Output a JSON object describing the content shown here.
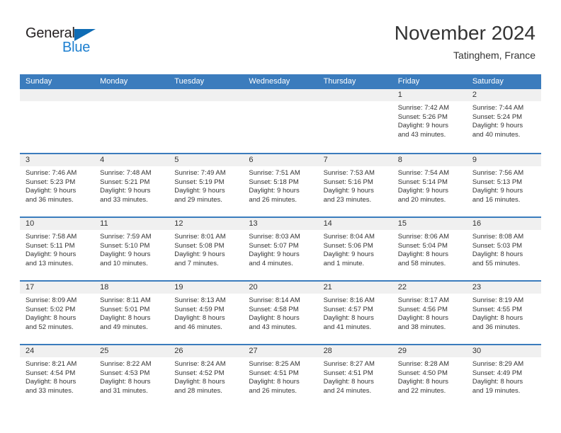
{
  "brand": {
    "name_part1": "General",
    "name_part2": "Blue",
    "triangle_color": "#0f6cb5",
    "blue_color": "#1c7fd0"
  },
  "header": {
    "title": "November 2024",
    "subtitle": "Tatinghem, France",
    "header_bg": "#3b7cbd",
    "daynum_bg": "#f0f0f0"
  },
  "weekday_headers": [
    "Sunday",
    "Monday",
    "Tuesday",
    "Wednesday",
    "Thursday",
    "Friday",
    "Saturday"
  ],
  "weeks": [
    [
      {
        "day": "",
        "lines": []
      },
      {
        "day": "",
        "lines": []
      },
      {
        "day": "",
        "lines": []
      },
      {
        "day": "",
        "lines": []
      },
      {
        "day": "",
        "lines": []
      },
      {
        "day": "1",
        "lines": [
          "Sunrise: 7:42 AM",
          "Sunset: 5:26 PM",
          "Daylight: 9 hours",
          "and 43 minutes."
        ]
      },
      {
        "day": "2",
        "lines": [
          "Sunrise: 7:44 AM",
          "Sunset: 5:24 PM",
          "Daylight: 9 hours",
          "and 40 minutes."
        ]
      }
    ],
    [
      {
        "day": "3",
        "lines": [
          "Sunrise: 7:46 AM",
          "Sunset: 5:23 PM",
          "Daylight: 9 hours",
          "and 36 minutes."
        ]
      },
      {
        "day": "4",
        "lines": [
          "Sunrise: 7:48 AM",
          "Sunset: 5:21 PM",
          "Daylight: 9 hours",
          "and 33 minutes."
        ]
      },
      {
        "day": "5",
        "lines": [
          "Sunrise: 7:49 AM",
          "Sunset: 5:19 PM",
          "Daylight: 9 hours",
          "and 29 minutes."
        ]
      },
      {
        "day": "6",
        "lines": [
          "Sunrise: 7:51 AM",
          "Sunset: 5:18 PM",
          "Daylight: 9 hours",
          "and 26 minutes."
        ]
      },
      {
        "day": "7",
        "lines": [
          "Sunrise: 7:53 AM",
          "Sunset: 5:16 PM",
          "Daylight: 9 hours",
          "and 23 minutes."
        ]
      },
      {
        "day": "8",
        "lines": [
          "Sunrise: 7:54 AM",
          "Sunset: 5:14 PM",
          "Daylight: 9 hours",
          "and 20 minutes."
        ]
      },
      {
        "day": "9",
        "lines": [
          "Sunrise: 7:56 AM",
          "Sunset: 5:13 PM",
          "Daylight: 9 hours",
          "and 16 minutes."
        ]
      }
    ],
    [
      {
        "day": "10",
        "lines": [
          "Sunrise: 7:58 AM",
          "Sunset: 5:11 PM",
          "Daylight: 9 hours",
          "and 13 minutes."
        ]
      },
      {
        "day": "11",
        "lines": [
          "Sunrise: 7:59 AM",
          "Sunset: 5:10 PM",
          "Daylight: 9 hours",
          "and 10 minutes."
        ]
      },
      {
        "day": "12",
        "lines": [
          "Sunrise: 8:01 AM",
          "Sunset: 5:08 PM",
          "Daylight: 9 hours",
          "and 7 minutes."
        ]
      },
      {
        "day": "13",
        "lines": [
          "Sunrise: 8:03 AM",
          "Sunset: 5:07 PM",
          "Daylight: 9 hours",
          "and 4 minutes."
        ]
      },
      {
        "day": "14",
        "lines": [
          "Sunrise: 8:04 AM",
          "Sunset: 5:06 PM",
          "Daylight: 9 hours",
          "and 1 minute."
        ]
      },
      {
        "day": "15",
        "lines": [
          "Sunrise: 8:06 AM",
          "Sunset: 5:04 PM",
          "Daylight: 8 hours",
          "and 58 minutes."
        ]
      },
      {
        "day": "16",
        "lines": [
          "Sunrise: 8:08 AM",
          "Sunset: 5:03 PM",
          "Daylight: 8 hours",
          "and 55 minutes."
        ]
      }
    ],
    [
      {
        "day": "17",
        "lines": [
          "Sunrise: 8:09 AM",
          "Sunset: 5:02 PM",
          "Daylight: 8 hours",
          "and 52 minutes."
        ]
      },
      {
        "day": "18",
        "lines": [
          "Sunrise: 8:11 AM",
          "Sunset: 5:01 PM",
          "Daylight: 8 hours",
          "and 49 minutes."
        ]
      },
      {
        "day": "19",
        "lines": [
          "Sunrise: 8:13 AM",
          "Sunset: 4:59 PM",
          "Daylight: 8 hours",
          "and 46 minutes."
        ]
      },
      {
        "day": "20",
        "lines": [
          "Sunrise: 8:14 AM",
          "Sunset: 4:58 PM",
          "Daylight: 8 hours",
          "and 43 minutes."
        ]
      },
      {
        "day": "21",
        "lines": [
          "Sunrise: 8:16 AM",
          "Sunset: 4:57 PM",
          "Daylight: 8 hours",
          "and 41 minutes."
        ]
      },
      {
        "day": "22",
        "lines": [
          "Sunrise: 8:17 AM",
          "Sunset: 4:56 PM",
          "Daylight: 8 hours",
          "and 38 minutes."
        ]
      },
      {
        "day": "23",
        "lines": [
          "Sunrise: 8:19 AM",
          "Sunset: 4:55 PM",
          "Daylight: 8 hours",
          "and 36 minutes."
        ]
      }
    ],
    [
      {
        "day": "24",
        "lines": [
          "Sunrise: 8:21 AM",
          "Sunset: 4:54 PM",
          "Daylight: 8 hours",
          "and 33 minutes."
        ]
      },
      {
        "day": "25",
        "lines": [
          "Sunrise: 8:22 AM",
          "Sunset: 4:53 PM",
          "Daylight: 8 hours",
          "and 31 minutes."
        ]
      },
      {
        "day": "26",
        "lines": [
          "Sunrise: 8:24 AM",
          "Sunset: 4:52 PM",
          "Daylight: 8 hours",
          "and 28 minutes."
        ]
      },
      {
        "day": "27",
        "lines": [
          "Sunrise: 8:25 AM",
          "Sunset: 4:51 PM",
          "Daylight: 8 hours",
          "and 26 minutes."
        ]
      },
      {
        "day": "28",
        "lines": [
          "Sunrise: 8:27 AM",
          "Sunset: 4:51 PM",
          "Daylight: 8 hours",
          "and 24 minutes."
        ]
      },
      {
        "day": "29",
        "lines": [
          "Sunrise: 8:28 AM",
          "Sunset: 4:50 PM",
          "Daylight: 8 hours",
          "and 22 minutes."
        ]
      },
      {
        "day": "30",
        "lines": [
          "Sunrise: 8:29 AM",
          "Sunset: 4:49 PM",
          "Daylight: 8 hours",
          "and 19 minutes."
        ]
      }
    ]
  ]
}
